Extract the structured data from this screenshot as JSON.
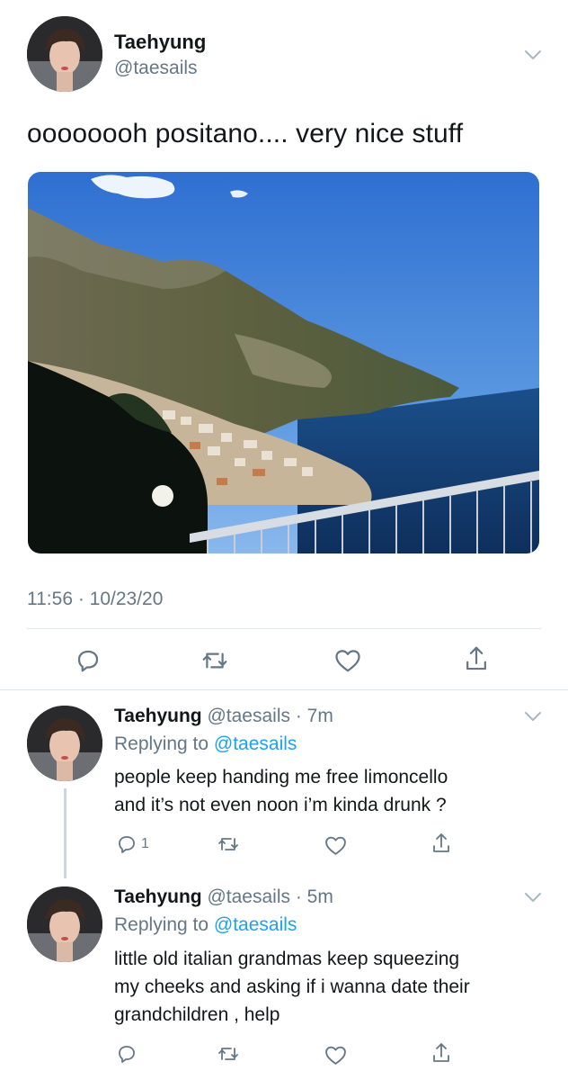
{
  "tweet": {
    "display_name": "Taehyung",
    "handle": "@taesails",
    "text": "oooooooh positano.... very nice stuff",
    "timestamp": "11:56 · 10/23/20",
    "image_alt": "Positano coastline photo"
  },
  "replies": [
    {
      "display_name": "Taehyung",
      "handle_time": "@taesails · 7m",
      "replying_prefix": "Replying to",
      "replying_to": "@taesails",
      "line1": "people keep handing me free limoncello",
      "line2": "and it’s not even noon i’m kinda drunk ?",
      "reply_count": "1"
    },
    {
      "display_name": "Taehyung",
      "handle_time": "@taesails · 5m",
      "replying_prefix": "Replying to",
      "replying_to": "@taesails",
      "line1": "little old italian grandmas keep squeezing",
      "line2": "my cheeks and asking if i wanna date their",
      "line3": "grandchildren , help"
    }
  ],
  "icons": {
    "reply": "reply-icon",
    "retweet": "retweet-icon",
    "like": "heart-icon",
    "share": "share-icon",
    "more": "chevron-down-icon"
  },
  "colors": {
    "text": "#14171a",
    "secondary": "#657786",
    "link": "#1da1f2",
    "divider": "#e1e8ed"
  }
}
